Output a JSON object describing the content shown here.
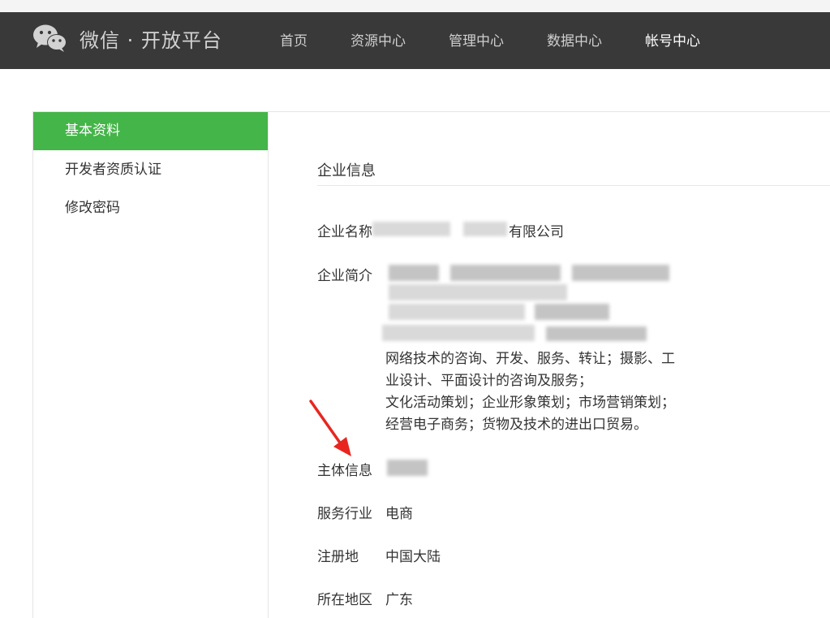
{
  "header": {
    "logo_icon": "wechat-logo-icon",
    "logo_text": "微信 · 开放平台",
    "nav": [
      {
        "label": "首页"
      },
      {
        "label": "资源中心"
      },
      {
        "label": "管理中心"
      },
      {
        "label": "数据中心"
      },
      {
        "label": "帐号中心",
        "active": true
      }
    ]
  },
  "sidebar": {
    "items": [
      {
        "label": "基本资料",
        "active": true
      },
      {
        "label": "开发者资质认证"
      },
      {
        "label": "修改密码"
      }
    ],
    "active_color": "#44b549"
  },
  "main": {
    "section_title": "企业信息",
    "company_name": {
      "label": "企业名称",
      "value_suffix": "有限公司"
    },
    "company_intro": {
      "label": "企业简介",
      "lines": [
        "网络技术的咨询、开发、服务、转让；摄影、工",
        "业设计、平面设计的咨询及服务；",
        "文化活动策划；企业形象策划；市场营销策划；",
        "经营电子商务；货物及技术的进出口贸易。"
      ]
    },
    "entity_info": {
      "label": "主体信息"
    },
    "service_industry": {
      "label": "服务行业",
      "value": "电商"
    },
    "registration": {
      "label": "注册地",
      "value": "中国大陆"
    },
    "region": {
      "label": "所在地区",
      "value": "广东"
    }
  },
  "annotation": {
    "arrow_color": "#e8261f"
  }
}
